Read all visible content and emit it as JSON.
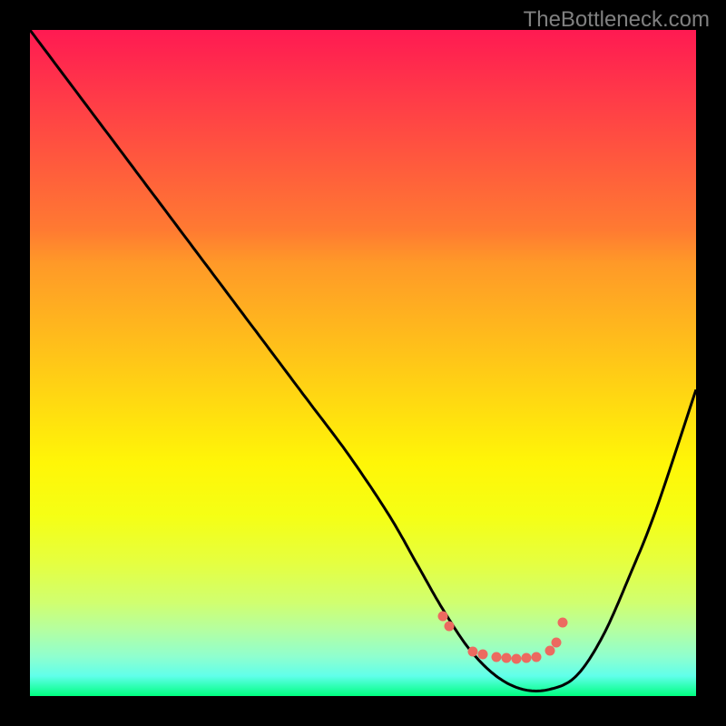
{
  "watermark": "TheBottleneck.com",
  "chart_data": {
    "type": "line",
    "title": "",
    "xlabel": "",
    "ylabel": "",
    "xlim": [
      0,
      100
    ],
    "ylim": [
      0,
      100
    ],
    "series": [
      {
        "name": "bottleneck-curve",
        "x": [
          0,
          6,
          12,
          18,
          24,
          30,
          36,
          42,
          48,
          54,
          58,
          62,
          66,
          70,
          74,
          78,
          82,
          86,
          90,
          94,
          100
        ],
        "y": [
          100,
          92,
          84,
          76,
          68,
          60,
          52,
          44,
          36,
          27,
          20,
          13,
          7,
          3,
          1,
          1,
          3,
          9,
          18,
          28,
          46
        ]
      }
    ],
    "highlight_points": {
      "name": "optimal-zone-dots",
      "color": "#ec6a60",
      "x": [
        62,
        63,
        66.5,
        68,
        70,
        71.5,
        73,
        74.5,
        76,
        78,
        79,
        80
      ],
      "y": [
        12,
        10.5,
        6.7,
        6.2,
        5.9,
        5.7,
        5.6,
        5.7,
        5.9,
        6.8,
        8,
        11
      ]
    },
    "gradient_colors": {
      "top": "#ff1a52",
      "mid": "#ffd712",
      "bottom": "#00ff80"
    }
  }
}
